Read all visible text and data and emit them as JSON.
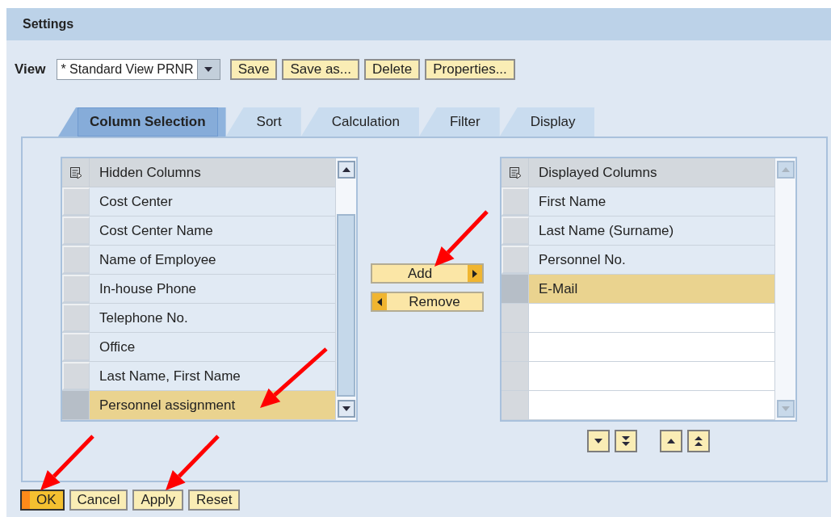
{
  "panel": {
    "title": "Settings"
  },
  "view": {
    "label": "View",
    "value": "* Standard View PRNR",
    "buttons": [
      "Save",
      "Save as...",
      "Delete",
      "Properties..."
    ]
  },
  "tabs": [
    {
      "label": "Column Selection",
      "selected": true
    },
    {
      "label": "Sort",
      "selected": false
    },
    {
      "label": "Calculation",
      "selected": false
    },
    {
      "label": "Filter",
      "selected": false
    },
    {
      "label": "Display",
      "selected": false
    }
  ],
  "hidden_columns": {
    "title": "Hidden Columns",
    "rows": [
      {
        "label": "Cost Center",
        "selected": false
      },
      {
        "label": "Cost Center Name",
        "selected": false
      },
      {
        "label": "Name of Employee",
        "selected": false
      },
      {
        "label": "In-house Phone",
        "selected": false
      },
      {
        "label": "Telephone No.",
        "selected": false
      },
      {
        "label": "Office",
        "selected": false
      },
      {
        "label": "Last Name, First Name",
        "selected": false
      },
      {
        "label": "Personnel assignment",
        "selected": true
      }
    ]
  },
  "move_buttons": [
    {
      "label": "Add",
      "kind": "add"
    },
    {
      "label": "Remove",
      "kind": "remove"
    }
  ],
  "displayed_columns": {
    "title": "Displayed Columns",
    "rows": [
      {
        "label": "First Name",
        "selected": false
      },
      {
        "label": "Last Name (Surname)",
        "selected": false
      },
      {
        "label": "Personnel No.",
        "selected": false
      },
      {
        "label": "E-Mail",
        "selected": true
      }
    ]
  },
  "footer_buttons": [
    {
      "label": "OK",
      "emphasized": true
    },
    {
      "label": "Cancel",
      "emphasized": false
    },
    {
      "label": "Apply",
      "emphasized": false
    },
    {
      "label": "Reset",
      "emphasized": false
    }
  ]
}
